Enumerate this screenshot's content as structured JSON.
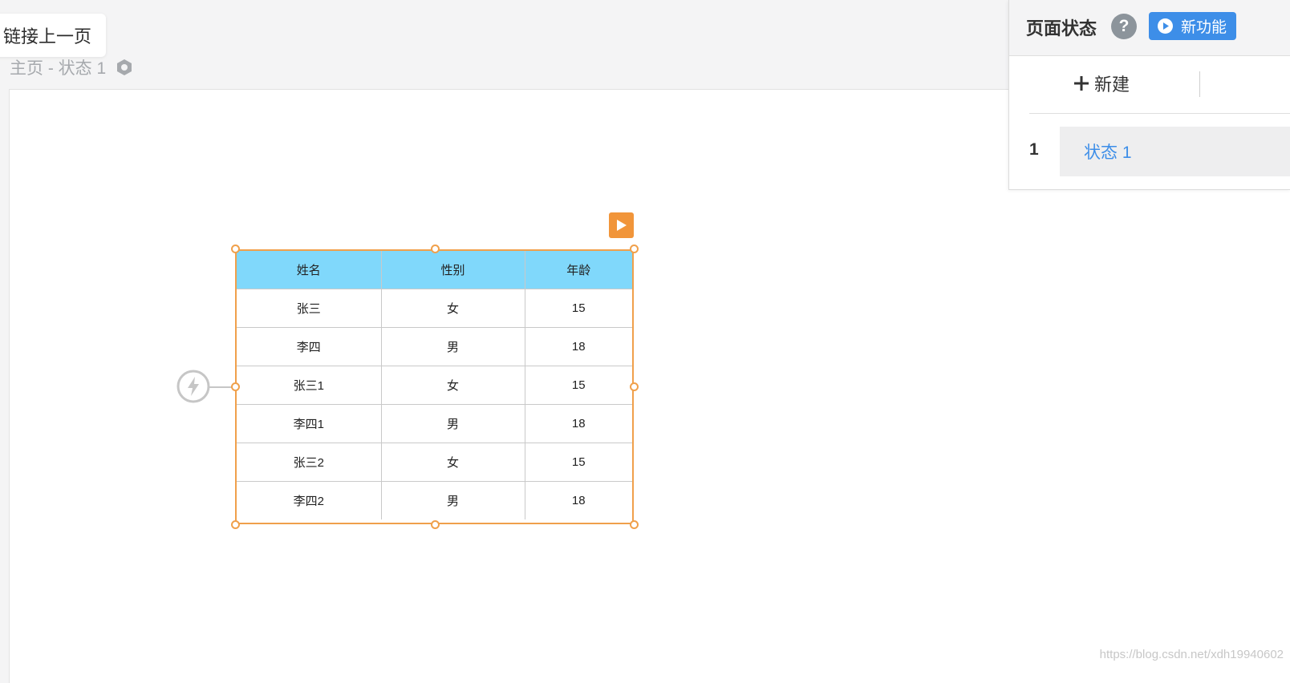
{
  "header": {
    "prev_link_label": "链接上一页",
    "breadcrumb": "主页 - 状态 1"
  },
  "table": {
    "headers": [
      "姓名",
      "性别",
      "年龄"
    ],
    "rows": [
      [
        "张三",
        "女",
        "15"
      ],
      [
        "李四",
        "男",
        "18"
      ],
      [
        "张三1",
        "女",
        "15"
      ],
      [
        "李四1",
        "男",
        "18"
      ],
      [
        "张三2",
        "女",
        "15"
      ],
      [
        "李四2",
        "男",
        "18"
      ]
    ],
    "header_color": "#80d8fb",
    "selection_color": "#f0a04b"
  },
  "panel": {
    "title": "页面状态",
    "help_label": "?",
    "new_feature_label": "新功能",
    "create_label": "新建",
    "states": [
      {
        "index": "1",
        "label": "状态 1"
      }
    ],
    "accent_color": "#3d8ee8"
  },
  "icons": {
    "settings": "hexagon-settings-icon",
    "play": "play-icon",
    "event": "lightning-icon",
    "help": "question-icon",
    "plus": "plus-icon"
  },
  "watermark": "https://blog.csdn.net/xdh19940602"
}
